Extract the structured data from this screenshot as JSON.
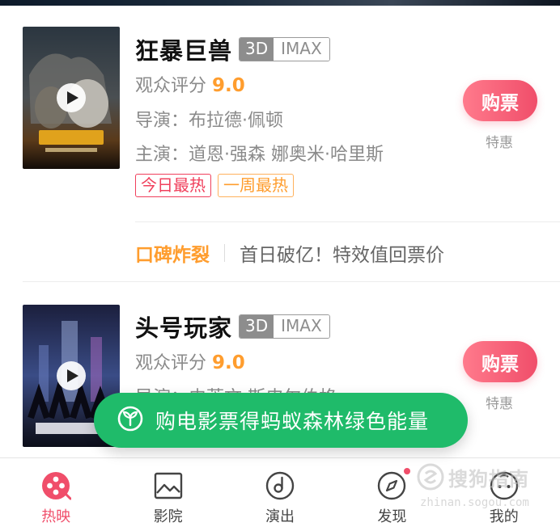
{
  "movies": [
    {
      "title": "狂暴巨兽",
      "format_3d": "3D",
      "format_imax": "IMAX",
      "score_label": "观众评分",
      "score": "9.0",
      "director": "导演：布拉德·佩顿",
      "cast": "主演：道恩·强森 娜奥米·哈里斯",
      "badges": [
        "今日最热",
        "一周最热"
      ],
      "buy_label": "购票",
      "buy_sub": "特惠",
      "praise_label": "口碑炸裂",
      "praise_text": "首日破亿！特效值回票价",
      "poster_icon": "play-icon"
    },
    {
      "title": "头号玩家",
      "format_3d": "3D",
      "format_imax": "IMAX",
      "score_label": "观众评分",
      "score": "9.0",
      "director": "导演：史蒂文·斯皮尔伯格",
      "buy_label": "购票",
      "buy_sub": "特惠",
      "poster_icon": "play-icon"
    }
  ],
  "toast": {
    "text": "购电影票得蚂蚁森林绿色能量",
    "icon": "sprout-icon"
  },
  "tabbar": {
    "tabs": [
      {
        "label": "热映",
        "icon": "film-reel-icon",
        "active": true
      },
      {
        "label": "影院",
        "icon": "picture-icon"
      },
      {
        "label": "演出",
        "icon": "music-disc-icon"
      },
      {
        "label": "发现",
        "icon": "compass-icon",
        "badge_dot": true
      },
      {
        "label": "我的",
        "icon": "profile-face-icon"
      }
    ]
  },
  "watermark": {
    "text": "搜狗指南",
    "url": "zhinan.sogou.com"
  },
  "colors": {
    "accent_pink": "#f04e6a",
    "score_orange": "#ff9d2e",
    "toast_green": "#1fbb6a"
  }
}
